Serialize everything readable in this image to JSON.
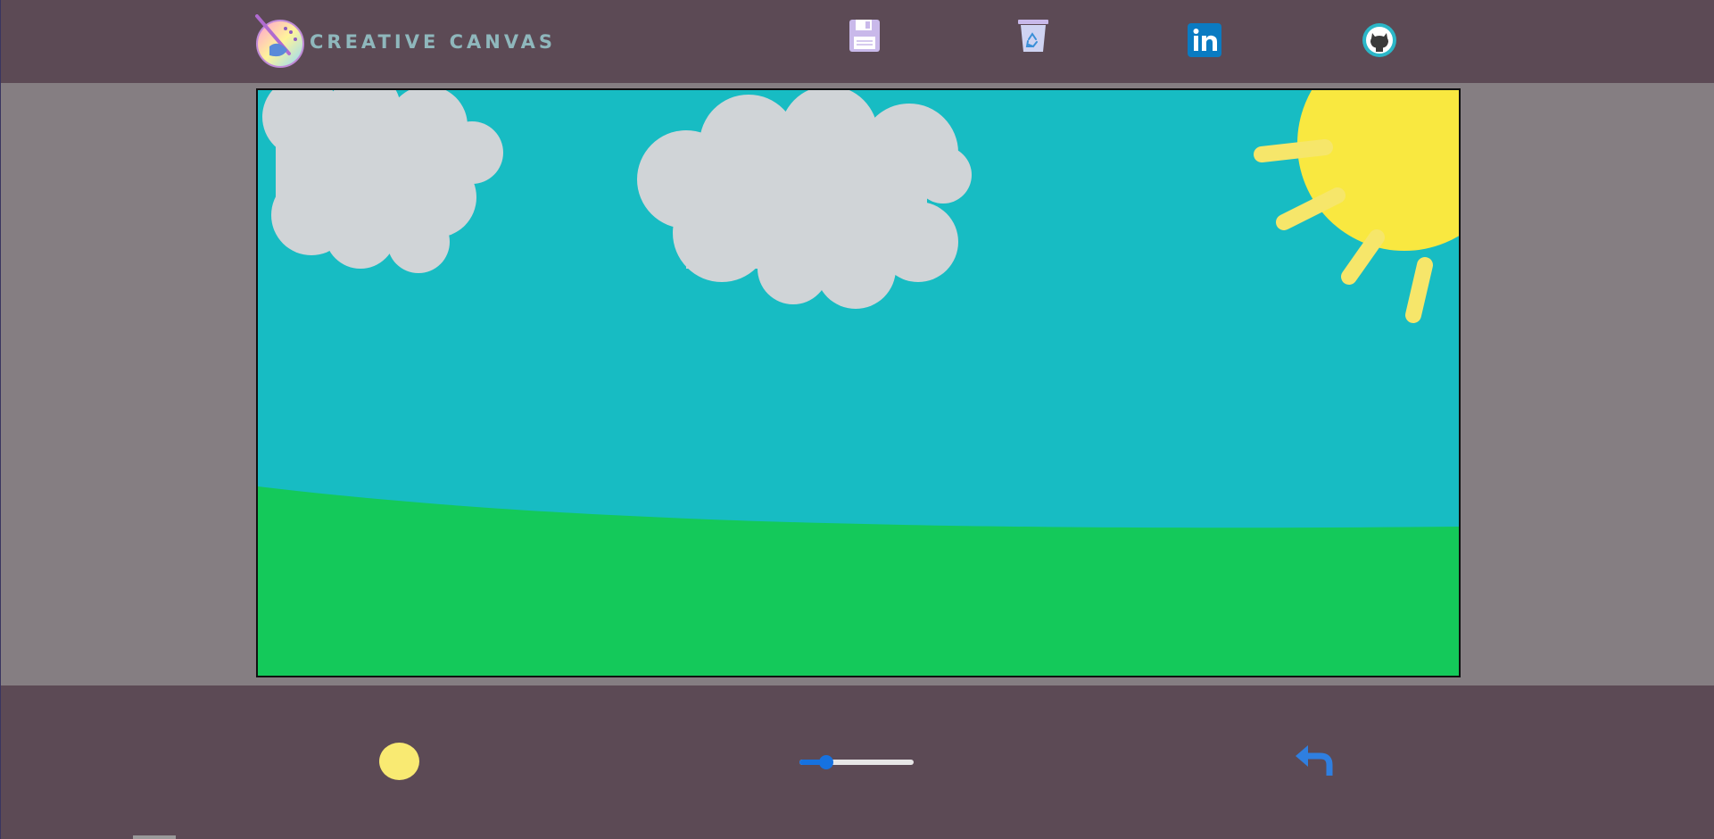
{
  "header": {
    "app_title": "CREATIVE CANVAS",
    "logo_icon": "palette-brush-icon",
    "tools": [
      {
        "name": "save",
        "icon": "floppy-disk-icon"
      },
      {
        "name": "clear",
        "icon": "recycle-bin-icon"
      },
      {
        "name": "linkedin",
        "icon": "linkedin-icon",
        "label": "in"
      },
      {
        "name": "github",
        "icon": "github-icon"
      }
    ]
  },
  "canvas": {
    "sky_color": "#17bcc3",
    "grass_color": "#14c95a",
    "cloud_color": "#d0d4d7",
    "sun_color": "#f9e840"
  },
  "footer": {
    "selected_color": "#f9ea72",
    "brush_size_fraction": 0.2,
    "undo_icon": "undo-arrow-icon"
  },
  "colors": {
    "bar": "#5c4a55",
    "background": "#857e82",
    "accent": "#1672e0"
  }
}
